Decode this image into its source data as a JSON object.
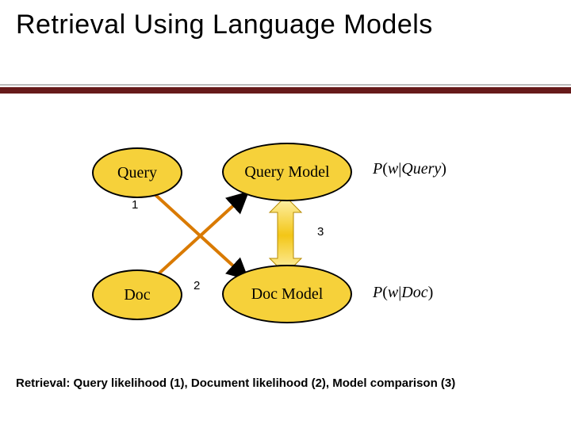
{
  "title": "Retrieval Using Language Models",
  "nodes": {
    "query": "Query",
    "queryModel": "Query Model",
    "doc": "Doc",
    "docModel": "Doc Model"
  },
  "labels": {
    "one": "1",
    "two": "2",
    "three": "3"
  },
  "formulas": {
    "pwQuery": "P(w|Query)",
    "pwDoc": "P(w|Doc)"
  },
  "caption": "Retrieval: Query likelihood (1), Document likelihood (2), Model comparison (3)"
}
